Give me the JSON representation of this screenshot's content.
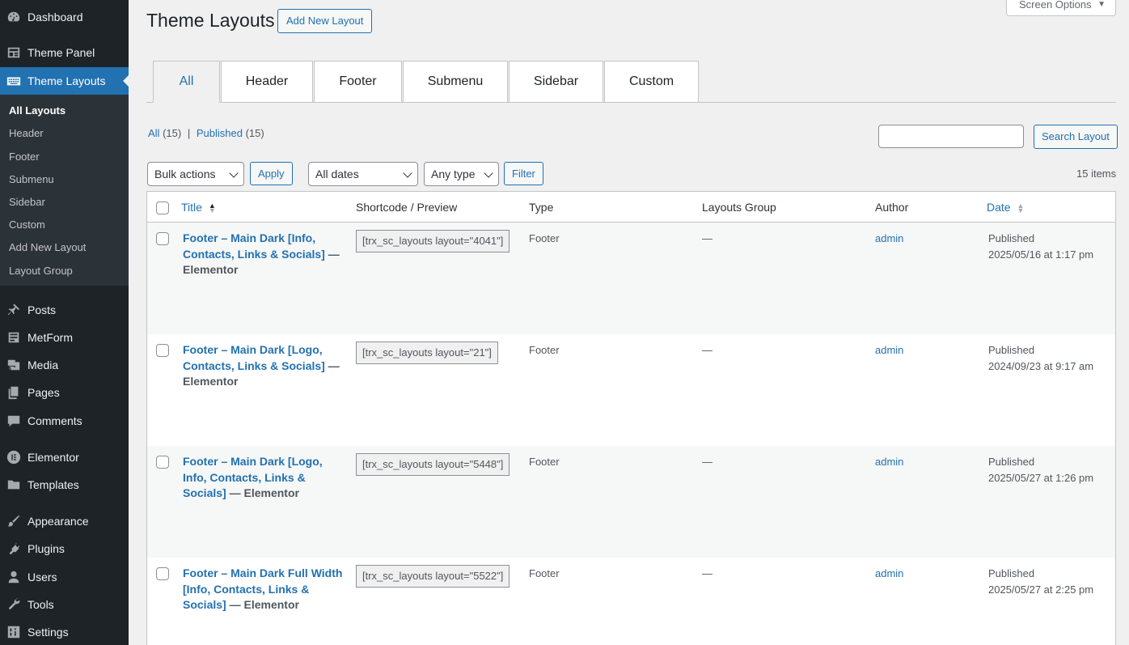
{
  "sidebar": {
    "menu": [
      {
        "label": "Dashboard",
        "icon": "dashboard-icon"
      },
      {
        "label": "Theme Panel",
        "icon": "theme-panel-icon"
      },
      {
        "label": "Theme Layouts",
        "icon": "keyboard-icon"
      },
      {
        "label": "Posts",
        "icon": "pin-icon"
      },
      {
        "label": "MetForm",
        "icon": "form-icon"
      },
      {
        "label": "Media",
        "icon": "media-icon"
      },
      {
        "label": "Pages",
        "icon": "pages-icon"
      },
      {
        "label": "Comments",
        "icon": "comment-icon"
      },
      {
        "label": "Elementor",
        "icon": "elementor-icon"
      },
      {
        "label": "Templates",
        "icon": "folder-icon"
      },
      {
        "label": "Appearance",
        "icon": "brush-icon"
      },
      {
        "label": "Plugins",
        "icon": "plug-icon"
      },
      {
        "label": "Users",
        "icon": "user-icon"
      },
      {
        "label": "Tools",
        "icon": "wrench-icon"
      },
      {
        "label": "Settings",
        "icon": "settings-icon"
      }
    ],
    "submenu": [
      "All Layouts",
      "Header",
      "Footer",
      "Submenu",
      "Sidebar",
      "Custom",
      "Add New Layout",
      "Layout Group"
    ]
  },
  "header": {
    "title": "Theme Layouts",
    "add_new": "Add New Layout",
    "screen_options": "Screen Options"
  },
  "tabs": [
    "All",
    "Header",
    "Footer",
    "Submenu",
    "Sidebar",
    "Custom"
  ],
  "views": {
    "all_label": "All",
    "all_count": "(15)",
    "sep": "|",
    "published_label": "Published",
    "published_count": "(15)"
  },
  "search": {
    "button": "Search Layout"
  },
  "filters": {
    "bulk": "Bulk actions",
    "apply": "Apply",
    "dates": "All dates",
    "type": "Any type",
    "filter": "Filter",
    "items": "15 items"
  },
  "table": {
    "columns": {
      "title": "Title",
      "shortcode": "Shortcode / Preview",
      "type": "Type",
      "group": "Layouts Group",
      "author": "Author",
      "date": "Date"
    },
    "rows": [
      {
        "title": "Footer – Main Dark [Info, Contacts, Links & Socials]",
        "state": " — Elementor",
        "shortcode": "[trx_sc_layouts layout=\"4041\"]",
        "type": "Footer",
        "group": "—",
        "author": "admin",
        "status": "Published",
        "date": "2025/05/16 at 1:17 pm"
      },
      {
        "title": "Footer – Main Dark [Logo, Contacts, Links & Socials]",
        "state": " — Elementor",
        "shortcode": "[trx_sc_layouts layout=\"21\"]",
        "type": "Footer",
        "group": "—",
        "author": "admin",
        "status": "Published",
        "date": "2024/09/23 at 9:17 am"
      },
      {
        "title": "Footer – Main Dark [Logo, Info, Contacts, Links & Socials]",
        "state": " — Elementor",
        "shortcode": "[trx_sc_layouts layout=\"5448\"]",
        "type": "Footer",
        "group": "—",
        "author": "admin",
        "status": "Published",
        "date": "2025/05/27 at 1:26 pm"
      },
      {
        "title": "Footer – Main Dark Full Width [Info, Contacts, Links & Socials]",
        "state": " — Elementor",
        "shortcode": "[trx_sc_layouts layout=\"5522\"]",
        "type": "Footer",
        "group": "—",
        "author": "admin",
        "status": "Published",
        "date": "2025/05/27 at 2:25 pm"
      }
    ]
  },
  "colors": {
    "accent": "#2271b1",
    "sidebar_bg": "#1d2327",
    "submenu_bg": "#2c3338"
  }
}
